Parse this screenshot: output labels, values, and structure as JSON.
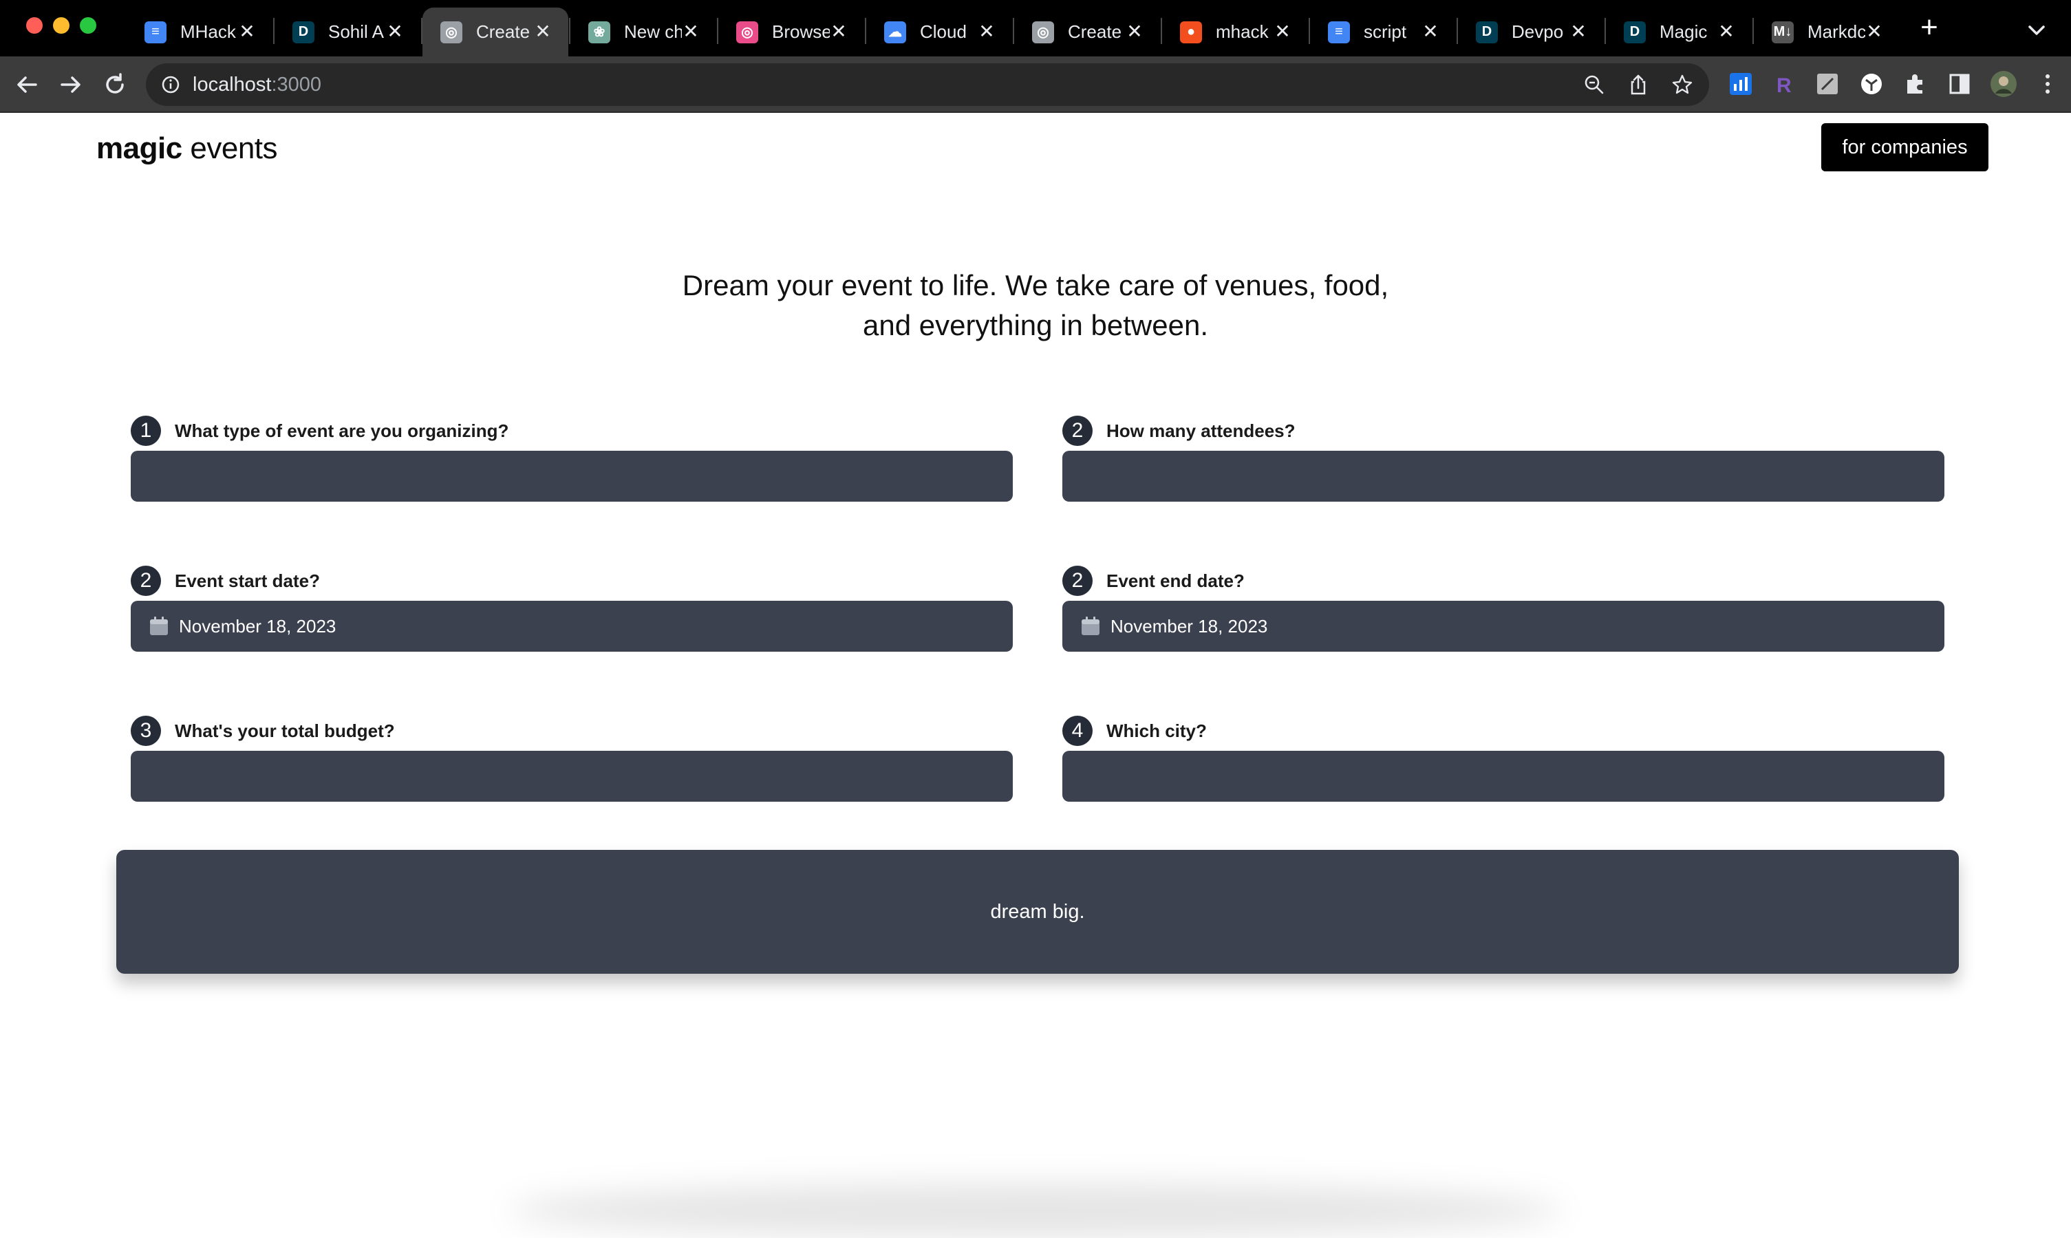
{
  "browser": {
    "tabs": [
      {
        "title": "MHack",
        "icon": "docs-icon",
        "color": "#4285f4"
      },
      {
        "title": "Sohil A",
        "icon": "devpost-icon",
        "color": "#003e54"
      },
      {
        "title": "Create",
        "icon": "globe-icon",
        "color": "#9aa0a6",
        "active": true
      },
      {
        "title": "New ch",
        "icon": "chatgpt-icon",
        "color": "#74aa9c"
      },
      {
        "title": "Browse",
        "icon": "dribbble-icon",
        "color": "#ea4c89"
      },
      {
        "title": "Cloud",
        "icon": "cloud-icon",
        "color": "#4285f4"
      },
      {
        "title": "Create",
        "icon": "globe-icon",
        "color": "#9aa0a6"
      },
      {
        "title": "mhack",
        "icon": "figma-icon",
        "color": "#f24e1e"
      },
      {
        "title": "script",
        "icon": "docs-icon",
        "color": "#4285f4"
      },
      {
        "title": "Devpo",
        "icon": "devpost-icon",
        "color": "#003e54"
      },
      {
        "title": "Magic",
        "icon": "devpost-icon",
        "color": "#003e54"
      },
      {
        "title": "Markdc",
        "icon": "markdown-icon",
        "color": "#555555"
      }
    ],
    "url_host": "localhost",
    "url_port": ":3000"
  },
  "header": {
    "logo_bold": "magic",
    "logo_rest": " events",
    "companies_label": "for companies"
  },
  "hero": {
    "line1": "Dream your event to life. We take care of venues, food,",
    "line2": "and everything in between."
  },
  "form": {
    "event_type": {
      "number": "1",
      "question": "What type of event are you organizing?",
      "value": ""
    },
    "attendees": {
      "number": "2",
      "question": "How many attendees?",
      "value": ""
    },
    "start_date": {
      "number": "2",
      "question": "Event start date?",
      "value": "November 18, 2023"
    },
    "end_date": {
      "number": "2",
      "question": "Event end date?",
      "value": "November 18, 2023"
    },
    "budget": {
      "number": "3",
      "question": "What's your total budget?",
      "value": ""
    },
    "city": {
      "number": "4",
      "question": "Which city?",
      "value": ""
    }
  },
  "submit": {
    "label": "dream big."
  }
}
